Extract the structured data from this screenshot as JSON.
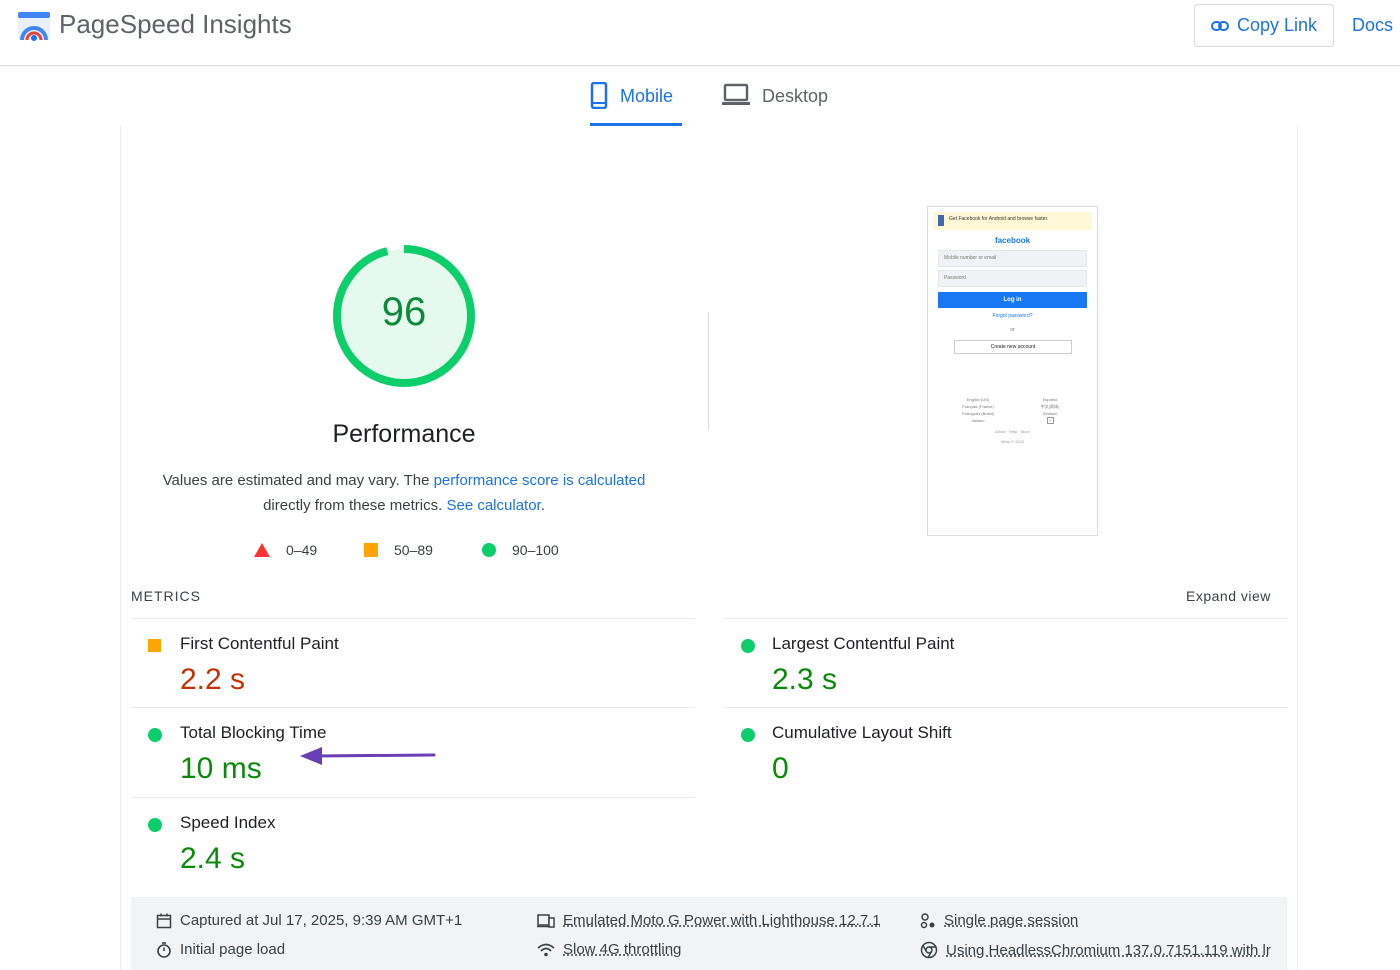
{
  "header": {
    "title": "PageSpeed Insights",
    "copy_link": "Copy Link",
    "docs": "Docs"
  },
  "tabs": [
    {
      "label": "Mobile",
      "active": true
    },
    {
      "label": "Desktop",
      "active": false
    }
  ],
  "score": {
    "value": 96,
    "category": "Performance",
    "color": "#0cce6b",
    "desc_prefix": "Values are estimated and may vary. The ",
    "desc_link": "performance score is calculated",
    "desc_middle": "directly from these metrics.",
    "desc_link2": "See calculator",
    "desc_end": "."
  },
  "legend": [
    {
      "shape": "triangle",
      "color": "#ff3333",
      "label": "0–49"
    },
    {
      "shape": "square",
      "color": "#ffa400",
      "label": "50–89"
    },
    {
      "shape": "circle",
      "color": "#0cce6b",
      "label": "90–100"
    }
  ],
  "thumbnail": {
    "banner": "Get Facebook for Android and browse faster.",
    "brand": "facebook",
    "email_placeholder": "Mobile number or email",
    "password_placeholder": "Password",
    "login": "Log in",
    "forgot": "Forgot password?",
    "or": "or",
    "create": "Create new account",
    "lang_left": [
      "English (US)",
      "Français (France)",
      "Português (Brasil)",
      "Italiano"
    ],
    "lang_right": [
      "Español",
      "中文(简体)",
      "Deutsch",
      "+"
    ],
    "links": "About · Help · More",
    "copyright": "Meta © 2025"
  },
  "metrics": {
    "title": "METRICS",
    "expand": "Expand view",
    "items": [
      {
        "label": "First Contentful Paint",
        "value": "2.2 s",
        "rating": "average"
      },
      {
        "label": "Largest Contentful Paint",
        "value": "2.3 s",
        "rating": "good"
      },
      {
        "label": "Total Blocking Time",
        "value": "10 ms",
        "rating": "good"
      },
      {
        "label": "Cumulative Layout Shift",
        "value": "0",
        "rating": "good"
      },
      {
        "label": "Speed Index",
        "value": "2.4 s",
        "rating": "good"
      }
    ]
  },
  "annotation": {
    "arrow_color": "#6a3fb5"
  },
  "footer": {
    "captured": "Captured at Jul 17, 2025, 9:39 AM GMT+1",
    "initial": "Initial page load",
    "emulated": "Emulated Moto G Power with Lighthouse 12.7.1",
    "throttling": "Slow 4G throttling",
    "session": "Single page session",
    "browser": "Using HeadlessChromium 137.0.7151.119 with lr"
  }
}
